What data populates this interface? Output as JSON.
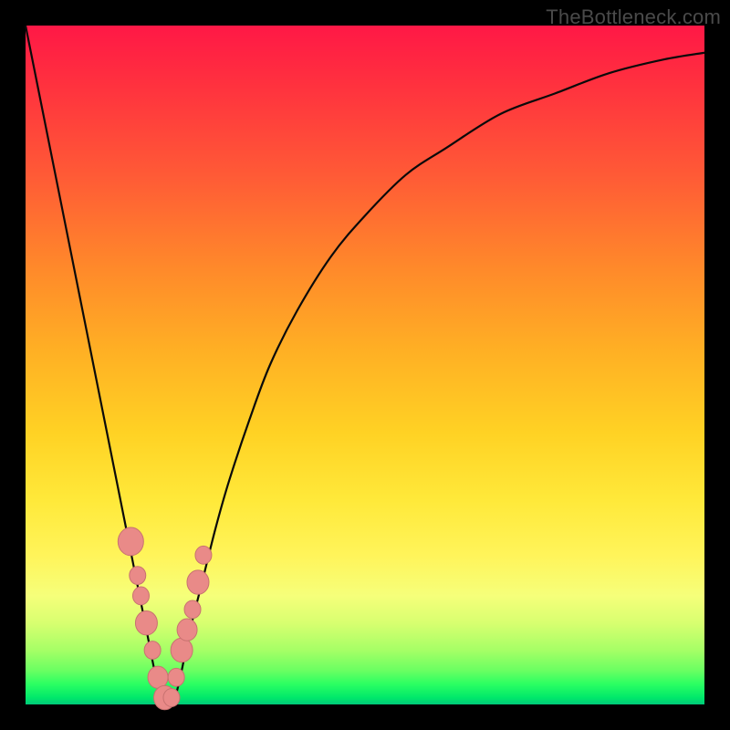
{
  "attribution": "TheBottleneck.com",
  "colors": {
    "frame_bg": "#000000",
    "curve": "#0a0a0a",
    "marker_fill": "#e98a88",
    "marker_stroke": "#c87270"
  },
  "chart_data": {
    "type": "line",
    "title": "",
    "xlabel": "",
    "ylabel": "",
    "ylim": [
      0,
      100
    ],
    "xlim": [
      0,
      100
    ],
    "series": [
      {
        "name": "bottleneck-curve",
        "x": [
          0,
          2,
          4,
          6,
          8,
          10,
          12,
          14,
          16,
          17,
          18,
          19,
          20,
          21,
          22,
          23,
          24,
          26,
          28,
          30,
          33,
          36,
          40,
          45,
          50,
          56,
          62,
          70,
          78,
          86,
          94,
          100
        ],
        "values": [
          100,
          90,
          80,
          70,
          60,
          50,
          40,
          30,
          20,
          15,
          10,
          5,
          1,
          0,
          1,
          5,
          10,
          18,
          26,
          33,
          42,
          50,
          58,
          66,
          72,
          78,
          82,
          87,
          90,
          93,
          95,
          96
        ]
      }
    ],
    "markers": {
      "name": "highlighted-points",
      "x": [
        15.5,
        16.5,
        17.0,
        17.8,
        18.7,
        19.5,
        20.5,
        21.5,
        22.2,
        23.0,
        23.8,
        24.6,
        25.4,
        26.2
      ],
      "values": [
        24,
        19,
        16,
        12,
        8,
        4,
        1,
        1,
        4,
        8,
        11,
        14,
        18,
        22
      ]
    }
  }
}
